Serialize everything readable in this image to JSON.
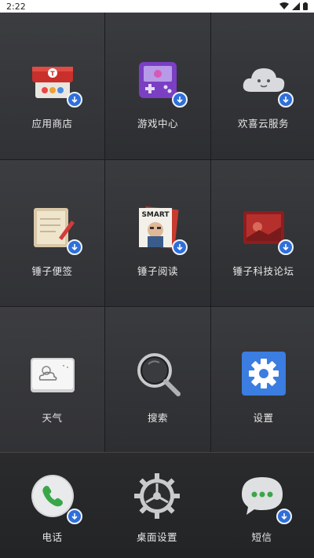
{
  "status": {
    "time": "2:22"
  },
  "tiles": [
    {
      "label": "应用商店"
    },
    {
      "label": "游戏中心"
    },
    {
      "label": "欢喜云服务"
    },
    {
      "label": "锤子便签"
    },
    {
      "label": "锤子阅读",
      "icon_text": "SMART"
    },
    {
      "label": "锤子科技论坛"
    },
    {
      "label": "天气"
    },
    {
      "label": "搜索"
    },
    {
      "label": "设置"
    }
  ],
  "dock": [
    {
      "label": "电话"
    },
    {
      "label": "桌面设置"
    },
    {
      "label": "短信"
    }
  ],
  "colors": {
    "badge": "#2f6fd8",
    "settings_bg": "#3b7de0",
    "phone_green": "#3aa64a"
  }
}
